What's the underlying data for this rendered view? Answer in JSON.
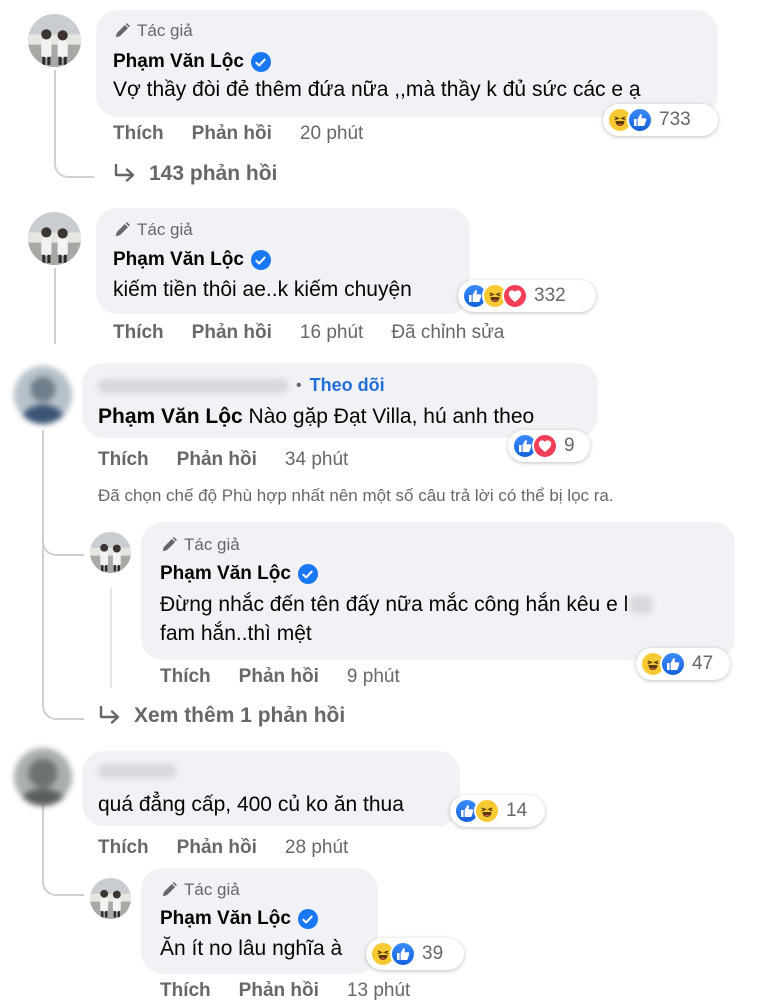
{
  "labels": {
    "author_badge": "Tác giả",
    "like": "Thích",
    "reply": "Phản hồi",
    "edited": "Đã chỉnh sửa",
    "follow": "Theo dõi"
  },
  "comments": [
    {
      "author": "Phạm Văn Lộc",
      "text": "Vợ thầy đòi đẻ thêm đứa nữa ,,mà thầy k đủ sức các e ạ",
      "time": "20 phút",
      "reaction_count": "733",
      "reactions": [
        "haha",
        "like"
      ]
    },
    {
      "author": "Phạm Văn Lộc",
      "text": "kiếm tiền thôi ae..k kiếm chuyện",
      "time": "16 phút",
      "reaction_count": "332",
      "reactions": [
        "like",
        "haha",
        "love"
      ]
    },
    {
      "mention": "Phạm Văn Lộc",
      "text": "Nào gặp Đạt Villa, hú anh theo",
      "time": "34 phút",
      "reaction_count": "9",
      "reactions": [
        "like",
        "love"
      ]
    },
    {
      "author": "Phạm Văn Lộc",
      "text_line1": "Đừng nhắc đến tên đấy nữa mắc công hắn kêu e l",
      "text_line2": "fam hắn..thì mệt",
      "time": "9 phút",
      "reaction_count": "47",
      "reactions": [
        "haha",
        "like"
      ]
    },
    {
      "text": "quá đẳng cấp, 400 củ ko ăn thua",
      "time": "28 phút",
      "reaction_count": "14",
      "reactions": [
        "like",
        "haha"
      ]
    },
    {
      "author": "Phạm Văn Lộc",
      "text": "Ăn ít no lâu nghĩa à",
      "time": "13 phút",
      "reaction_count": "39",
      "reactions": [
        "haha",
        "like"
      ]
    }
  ],
  "more_replies_1": "143 phản hồi",
  "more_replies_2": "Xem thêm 1 phản hồi",
  "filter_note": "Đã chọn chế độ Phù hợp nhất nên một số câu trả lời có thể bị lọc ra.",
  "colors": {
    "bubble": "#f0f2f5",
    "secondary_text": "#65676b",
    "link_blue": "#216fdb",
    "verified_blue": "#1877f2",
    "like_blue": "#1877f2",
    "haha_yellow": "#f7c933",
    "love_red": "#f33e58"
  }
}
